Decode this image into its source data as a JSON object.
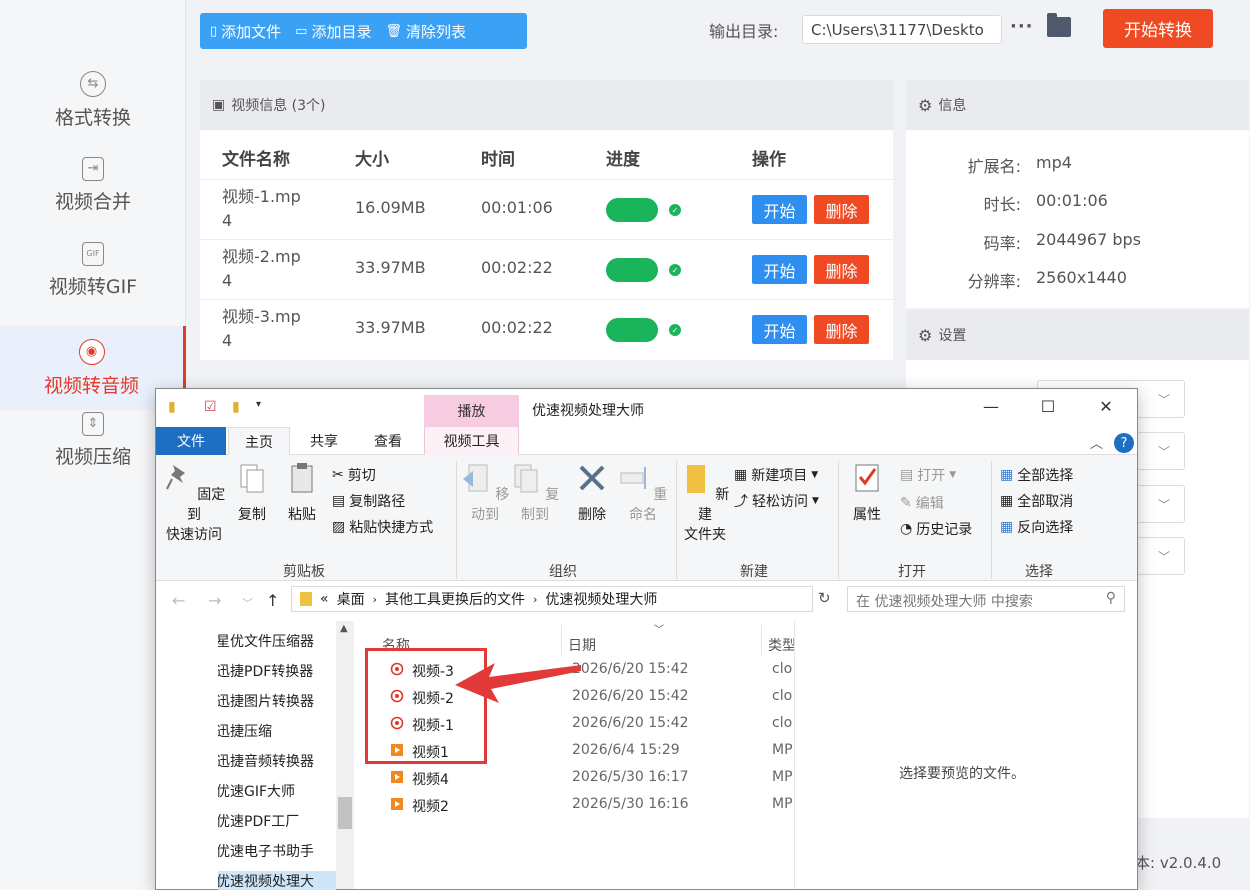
{
  "sidebar": {
    "items": [
      {
        "label": "格式转换",
        "icon": "convert-icon"
      },
      {
        "label": "视频合并",
        "icon": "merge-icon"
      },
      {
        "label": "视频转GIF",
        "icon": "gif-icon"
      },
      {
        "label": "视频转音频",
        "icon": "audio-icon",
        "active": true
      },
      {
        "label": "视频压缩",
        "icon": "compress-icon"
      }
    ]
  },
  "toolbar": {
    "add_file": "添加文件",
    "add_dir": "添加目录",
    "clear_list": "清除列表",
    "output_label": "输出目录:",
    "output_path": "C:\\Users\\31177\\Deskto",
    "more": "···",
    "start_convert": "开始转换"
  },
  "video_panel": {
    "title": "视频信息 (3个)",
    "columns": [
      "文件名称",
      "大小",
      "时间",
      "进度",
      "操作"
    ],
    "rows": [
      {
        "name_line1": "视频-1.mp",
        "name_line2": "4",
        "size": "16.09MB",
        "time": "00:01:06",
        "progress": 1.0
      },
      {
        "name_line1": "视频-2.mp",
        "name_line2": "4",
        "size": "33.97MB",
        "time": "00:02:22",
        "progress": 1.0
      },
      {
        "name_line1": "视频-3.mp",
        "name_line2": "4",
        "size": "33.97MB",
        "time": "00:02:22",
        "progress": 1.0
      }
    ],
    "start_label": "开始",
    "delete_label": "删除"
  },
  "info_panel": {
    "title": "信息",
    "rows": [
      {
        "key": "扩展名:",
        "value": "mp4"
      },
      {
        "key": "时长:",
        "value": "00:01:06"
      },
      {
        "key": "码率:",
        "value": "2044967 bps"
      },
      {
        "key": "分辨率:",
        "value": "2560x1440"
      }
    ]
  },
  "settings_panel": {
    "title": "设置"
  },
  "version": "本: v2.0.4.0",
  "explorer": {
    "title": "优速视频处理大师",
    "play_tab": "播放",
    "tabs": {
      "file": "文件",
      "home": "主页",
      "share": "共享",
      "view": "查看",
      "video_tools": "视频工具"
    },
    "ribbon": {
      "pin": "固定到",
      "pin2": "快速访问",
      "copy": "复制",
      "paste": "粘贴",
      "cut": "剪切",
      "copy_path": "复制路径",
      "paste_shortcut": "粘贴快捷方式",
      "clipboard": "剪贴板",
      "move_to": "移动到",
      "copy_to": "复制到",
      "delete": "删除",
      "rename": "重命名",
      "organize": "组织",
      "new_folder": "新建",
      "new_folder2": "文件夹",
      "new_item": "新建项目",
      "easy_access": "轻松访问",
      "new_group": "新建",
      "properties": "属性",
      "open": "打开",
      "edit": "编辑",
      "history": "历史记录",
      "open_group": "打开",
      "select_all": "全部选择",
      "select_none": "全部取消",
      "invert_select": "反向选择",
      "select_group": "选择"
    },
    "address": {
      "prefix": "«",
      "crumbs": [
        "桌面",
        "其他工具更换后的文件",
        "优速视频处理大师"
      ],
      "search_placeholder": "在 优速视频处理大师 中搜索"
    },
    "nav_items": [
      "星优文件压缩器",
      "迅捷PDF转换器",
      "迅捷图片转换器",
      "迅捷压缩",
      "迅捷音频转换器",
      "优速GIF大师",
      "优速PDF工厂",
      "优速电子书助手",
      "优速视频处理大"
    ],
    "columns": {
      "name": "名称",
      "date": "日期",
      "type": "类型"
    },
    "files": [
      {
        "name": "视频-3",
        "date": "2026/6/20 15:42",
        "type": "clo",
        "kind": "audio"
      },
      {
        "name": "视频-2",
        "date": "2026/6/20 15:42",
        "type": "clo",
        "kind": "audio"
      },
      {
        "name": "视频-1",
        "date": "2026/6/20 15:42",
        "type": "clo",
        "kind": "audio"
      },
      {
        "name": "视频1",
        "date": "2026/6/4 15:29",
        "type": "MP",
        "kind": "video"
      },
      {
        "name": "视频4",
        "date": "2026/5/30 16:17",
        "type": "MP",
        "kind": "video"
      },
      {
        "name": "视频2",
        "date": "2026/5/30 16:16",
        "type": "MP",
        "kind": "video"
      }
    ],
    "preview_text": "选择要预览的文件。"
  }
}
